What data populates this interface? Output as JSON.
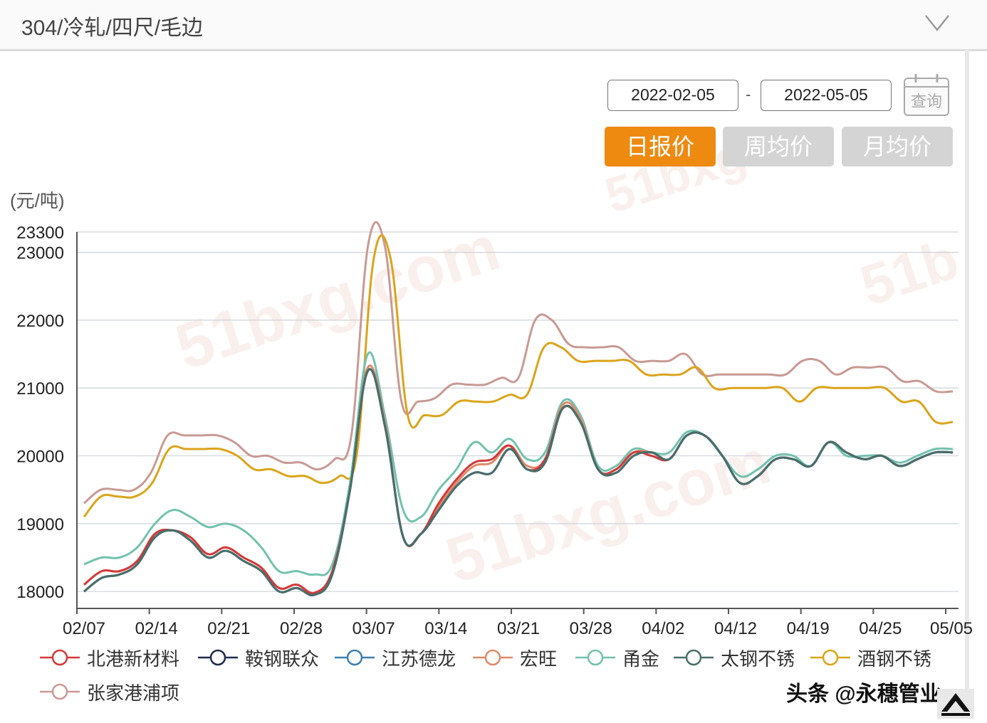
{
  "header": {
    "title": "304/冷轧/四尺/毛边"
  },
  "date_range": {
    "start": "2022-02-05",
    "separator": "-",
    "end": "2022-05-05",
    "query_label": "查询"
  },
  "tabs": [
    {
      "label": "日报价",
      "active": true
    },
    {
      "label": "周均价",
      "active": false
    },
    {
      "label": "月均价",
      "active": false
    }
  ],
  "footer": {
    "author": "头条 @永穗管业"
  },
  "colors": {
    "accent": "#ee8a10",
    "inactive_tab": "#d4d4d4"
  },
  "chart_data": {
    "type": "line",
    "ylabel": "(元/吨)",
    "y_ticks": [
      18000,
      19000,
      20000,
      21000,
      22000,
      23000,
      23300
    ],
    "ylim": [
      17750,
      23300
    ],
    "x_tick_labels": [
      "02/07",
      "02/14",
      "02/21",
      "02/28",
      "03/07",
      "03/14",
      "03/21",
      "03/28",
      "04/02",
      "04/12",
      "04/19",
      "04/25",
      "05/05"
    ],
    "grid": "horizontal",
    "legend_position": "bottom",
    "series": [
      {
        "name": "北港新材料",
        "color": "#d23a3a",
        "values": [
          18100,
          18300,
          18300,
          18450,
          18850,
          18900,
          18800,
          18550,
          18650,
          18500,
          18350,
          18050,
          18100,
          17980,
          18300,
          19500,
          21250,
          20400,
          18800,
          18850,
          19300,
          19650,
          19900,
          19950,
          20150,
          19800,
          19950,
          20700,
          20500,
          19800,
          19800,
          20050,
          20000,
          19950,
          20300,
          20300,
          20000,
          19600,
          19700,
          19950,
          19950,
          19850,
          20200,
          20050,
          19950,
          20000,
          19850,
          19950,
          20050,
          20050
        ]
      },
      {
        "name": "鞍钢联众",
        "color": "#1e2c4a",
        "values": [
          18000,
          18200,
          18250,
          18400,
          18800,
          18900,
          18750,
          18500,
          18600,
          18450,
          18300,
          18000,
          18050,
          17950,
          18250,
          19500,
          21250,
          20400,
          18800,
          18850,
          19200,
          19550,
          19750,
          19750,
          20100,
          19800,
          19900,
          20700,
          20500,
          19800,
          19750,
          20000,
          20050,
          19950,
          20300,
          20300,
          20000,
          19600,
          19700,
          19950,
          19950,
          19850,
          20200,
          20050,
          19950,
          20000,
          19850,
          19950,
          20050,
          20050
        ]
      },
      {
        "name": "江苏德龙",
        "color": "#3f7fae",
        "values": [
          18000,
          18200,
          18250,
          18400,
          18800,
          18900,
          18750,
          18500,
          18600,
          18450,
          18300,
          18000,
          18050,
          17950,
          18250,
          19500,
          21250,
          20400,
          18800,
          18850,
          19200,
          19550,
          19750,
          19750,
          20100,
          19800,
          19900,
          20700,
          20500,
          19800,
          19750,
          20000,
          20050,
          19950,
          20300,
          20300,
          20000,
          19600,
          19700,
          19950,
          19950,
          19850,
          20200,
          20050,
          19950,
          20000,
          19850,
          19950,
          20050,
          20050
        ]
      },
      {
        "name": "宏旺",
        "color": "#e08a6a",
        "values": [
          18100,
          18300,
          18300,
          18450,
          18850,
          18900,
          18800,
          18550,
          18650,
          18500,
          18350,
          18050,
          18100,
          17980,
          18300,
          19500,
          21300,
          20450,
          18800,
          18850,
          19250,
          19600,
          19850,
          19900,
          20150,
          19850,
          19950,
          20750,
          20550,
          19800,
          19800,
          20050,
          20050,
          19950,
          20300,
          20300,
          20000,
          19600,
          19700,
          19950,
          19950,
          19850,
          20200,
          20050,
          19950,
          20000,
          19850,
          19950,
          20050,
          20050
        ]
      },
      {
        "name": "甬金",
        "color": "#72c2ae",
        "values": [
          18400,
          18500,
          18500,
          18650,
          19000,
          19200,
          19100,
          18950,
          19000,
          18900,
          18650,
          18300,
          18300,
          18250,
          18400,
          19600,
          21500,
          20550,
          19200,
          19100,
          19500,
          19800,
          20200,
          20050,
          20250,
          19950,
          20050,
          20800,
          20600,
          19850,
          19850,
          20100,
          20050,
          20050,
          20350,
          20300,
          20000,
          19700,
          19800,
          20000,
          20000,
          19850,
          20200,
          20000,
          20000,
          20000,
          19900,
          20000,
          20100,
          20100
        ]
      },
      {
        "name": "太钢不锈",
        "color": "#4a6e6a",
        "values": [
          18000,
          18200,
          18250,
          18400,
          18800,
          18900,
          18750,
          18500,
          18600,
          18450,
          18300,
          18000,
          18050,
          17950,
          18250,
          19500,
          21250,
          20400,
          18800,
          18850,
          19200,
          19550,
          19750,
          19750,
          20100,
          19800,
          19900,
          20700,
          20500,
          19800,
          19750,
          20000,
          20050,
          19950,
          20300,
          20300,
          20000,
          19600,
          19700,
          19950,
          19950,
          19850,
          20200,
          20050,
          19950,
          20000,
          19850,
          19950,
          20050,
          20050
        ]
      },
      {
        "name": "酒钢不锈",
        "color": "#dba41a",
        "values": [
          19100,
          19400,
          19400,
          19400,
          19600,
          20100,
          20100,
          20100,
          20100,
          20000,
          19800,
          19800,
          19700,
          19700,
          19600,
          19700,
          20000,
          22900,
          22900,
          20600,
          20600,
          20600,
          20800,
          20800,
          20800,
          20900,
          20900,
          21600,
          21600,
          21400,
          21400,
          21400,
          21400,
          21200,
          21200,
          21200,
          21300,
          21000,
          21000,
          21000,
          21000,
          21000,
          20800,
          21000,
          21000,
          21000,
          21000,
          21000,
          20800,
          20800,
          20500,
          20500
        ]
      },
      {
        "name": "张家港浦项",
        "color": "#c89a94",
        "values": [
          19300,
          19500,
          19500,
          19500,
          19750,
          20300,
          20300,
          20300,
          20300,
          20200,
          20000,
          20000,
          19900,
          19900,
          19800,
          19950,
          20300,
          23100,
          23100,
          20800,
          20800,
          20850,
          21050,
          21050,
          21050,
          21150,
          21150,
          22000,
          22000,
          21650,
          21600,
          21600,
          21600,
          21400,
          21400,
          21400,
          21500,
          21200,
          21200,
          21200,
          21200,
          21200,
          21200,
          21400,
          21400,
          21200,
          21300,
          21300,
          21300,
          21100,
          21100,
          20950,
          20950
        ]
      }
    ]
  }
}
